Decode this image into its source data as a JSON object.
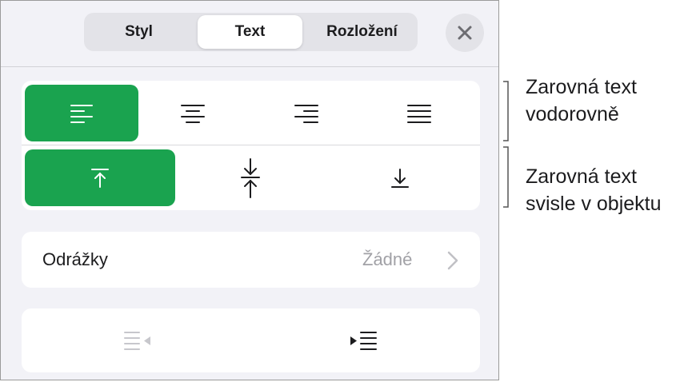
{
  "tabs": [
    {
      "label": "Styl"
    },
    {
      "label": "Text"
    },
    {
      "label": "Rozložení"
    }
  ],
  "selected_tab": "Text",
  "icons": {
    "close": "close-icon",
    "horizontal": [
      "align-left-icon",
      "align-center-icon",
      "align-right-icon",
      "justify-icon"
    ],
    "vertical": [
      "align-top-icon",
      "align-middle-icon",
      "align-bottom-icon"
    ],
    "indent": [
      "decrease-indent-icon",
      "increase-indent-icon"
    ]
  },
  "alignment": {
    "horizontal_selected": "left",
    "vertical_selected": "top"
  },
  "bullets": {
    "label": "Odrážky",
    "value": "Žádné"
  },
  "annotations": {
    "horizontal": [
      "Zarovná text",
      "vodorovně"
    ],
    "vertical": [
      "Zarovná text",
      "svisle v objektu"
    ]
  },
  "colors": {
    "accent": "#1aa34f",
    "panel_bg": "#f2f2f7",
    "card_bg": "#ffffff",
    "secondary_text": "#a1a1a6"
  }
}
